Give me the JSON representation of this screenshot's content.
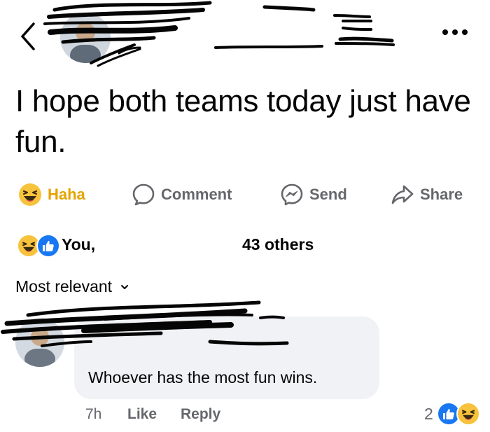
{
  "header": {
    "back_icon": "chevron-left-icon",
    "more_icon": "ellipsis-icon"
  },
  "post": {
    "text": "I hope both teams today just have fun."
  },
  "actions": {
    "haha": "Haha",
    "comment": "Comment",
    "send": "Send",
    "share": "Share"
  },
  "reactions": {
    "you": "You,",
    "others": "43 others",
    "icons": [
      "haha-reaction-icon",
      "like-reaction-icon"
    ]
  },
  "comments": {
    "sort_label": "Most relevant",
    "items": [
      {
        "text": "Whoever has the most fun wins.",
        "time": "7h",
        "like_label": "Like",
        "reply_label": "Reply",
        "reaction_count": "2"
      }
    ]
  },
  "colors": {
    "haha": "#e4a300",
    "like_blue": "#1877f2",
    "muted": "#65676b",
    "bubble": "#f0f2f5"
  }
}
